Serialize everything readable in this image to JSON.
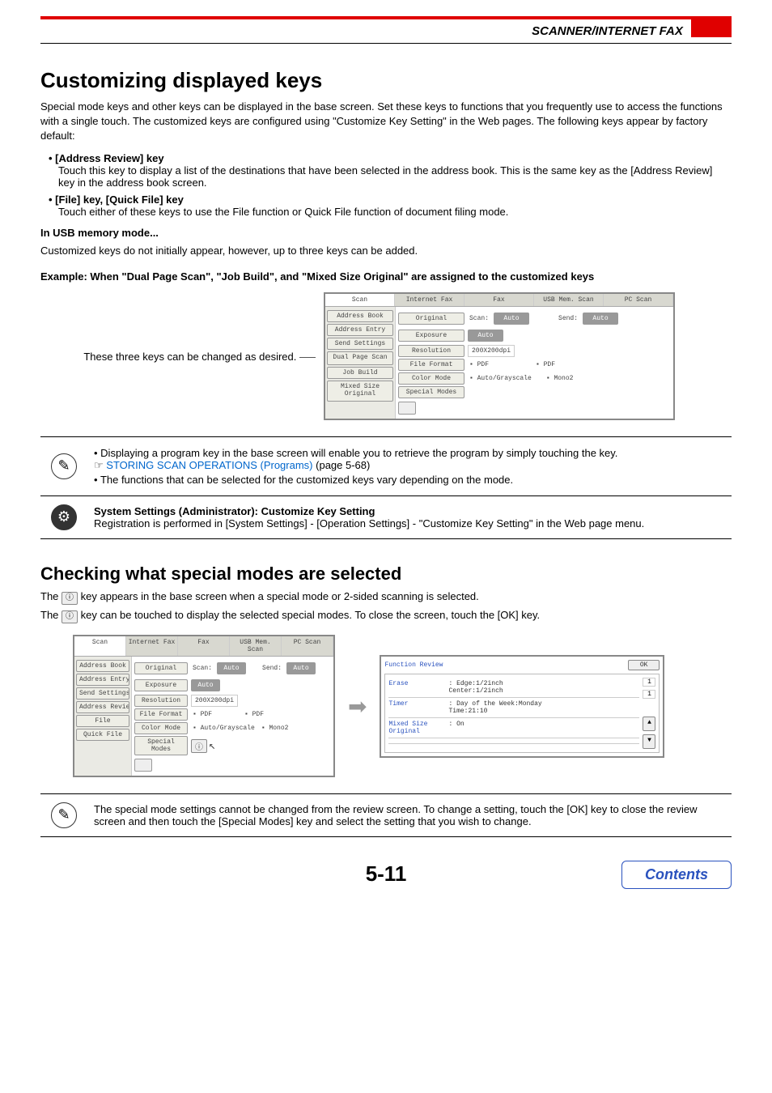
{
  "header": {
    "title": "SCANNER/INTERNET FAX"
  },
  "section1": {
    "heading": "Customizing displayed keys",
    "intro": "Special mode keys and other keys can be displayed in the base screen. Set these keys to functions that you frequently use to access the functions with a single touch. The customized keys are configured using \"Customize Key Setting\" in the Web pages. The following keys appear by factory default:",
    "items": [
      {
        "title": "[Address Review] key",
        "desc": "Touch this key to display a list of the destinations that have been selected in the address book. This is the same key as the [Address Review] key in the address book screen."
      },
      {
        "title": "[File] key, [Quick File] key",
        "desc": "Touch either of these keys to use the File function or Quick File function of document filing mode."
      }
    ],
    "usb_heading": "In USB memory mode...",
    "usb_desc": "Customized keys do not initially appear, however, up to three keys can be added.",
    "example": "Example: When \"Dual Page Scan\", \"Job Build\", and \"Mixed Size Original\" are assigned to the customized keys",
    "caption": "These three keys can be changed as desired."
  },
  "panelA": {
    "tabs": [
      "Scan",
      "Internet Fax",
      "Fax",
      "USB Mem. Scan",
      "PC Scan"
    ],
    "side": [
      "Address Book",
      "Address Entry",
      "Send Settings",
      "Dual Page\nScan",
      "Job Build",
      "Mixed Size\nOriginal"
    ],
    "rows": {
      "original": "Original",
      "scan_lbl": "Scan:",
      "scan_val": "Auto",
      "send_lbl": "Send:",
      "send_val": "Auto",
      "exposure": "Exposure",
      "exposure_val": "Auto",
      "resolution": "Resolution",
      "resolution_val": "200X200dpi",
      "fileformat": "File Format",
      "ff_left": "PDF",
      "ff_right": "PDF",
      "colormode": "Color Mode",
      "cm_left": "Auto/Grayscale",
      "cm_right": "Mono2",
      "special": "Special Modes"
    }
  },
  "note1": {
    "line1a": "Displaying a program key in the base screen will enable you to retrieve the program by simply touching the key.",
    "link": "STORING SCAN OPERATIONS (Programs)",
    "link_page": "(page 5-68)",
    "line2": "The functions that can be selected for the customized keys vary depending on the mode."
  },
  "note2": {
    "title": "System Settings (Administrator): Customize Key Setting",
    "desc": "Registration is performed in [System Settings] - [Operation Settings] - \"Customize Key Setting\" in the Web page menu."
  },
  "section2": {
    "heading": "Checking what special modes are selected",
    "para1_before": "The ",
    "para1_after": " key appears in the base screen when a special mode or 2-sided scanning is selected.",
    "para2_before": "The ",
    "para2_after": " key can be touched to display the selected special modes. To close the screen, touch the [OK] key.",
    "icon_glyph": "ⓘ"
  },
  "panelB": {
    "tabs": [
      "Scan",
      "Internet Fax",
      "Fax",
      "USB Mem. Scan",
      "PC Scan"
    ],
    "side": [
      "Address Book",
      "Address Entry",
      "Send Settings",
      "Address Review",
      "File",
      "Quick File"
    ],
    "rows": {
      "original": "Original",
      "scan_lbl": "Scan:",
      "scan_val": "Auto",
      "send_lbl": "Send:",
      "send_val": "Auto",
      "exposure": "Exposure",
      "exposure_val": "Auto",
      "resolution": "Resolution",
      "resolution_val": "200X200dpi",
      "fileformat": "File Format",
      "ff_left": "PDF",
      "ff_right": "PDF",
      "colormode": "Color Mode",
      "cm_left": "Auto/Grayscale",
      "cm_right": "Mono2",
      "special": "Special Modes"
    }
  },
  "review": {
    "title": "Function Review",
    "ok": "OK",
    "rows": [
      {
        "label": "Erase",
        "val": "Edge:1/2inch\nCenter:1/2inch"
      },
      {
        "label": "Timer",
        "val": "Day of the Week:Monday\nTime:21:10"
      },
      {
        "label": "Mixed Size Original",
        "val": "On"
      }
    ],
    "page_cur": "1",
    "page_tot": "1"
  },
  "note3": {
    "text": "The special mode settings cannot be changed from the review screen. To change a setting, touch the [OK] key to close the review screen and then touch the [Special Modes] key and select the setting that you wish to change."
  },
  "footer": {
    "page_num": "5-11",
    "contents": "Contents"
  }
}
